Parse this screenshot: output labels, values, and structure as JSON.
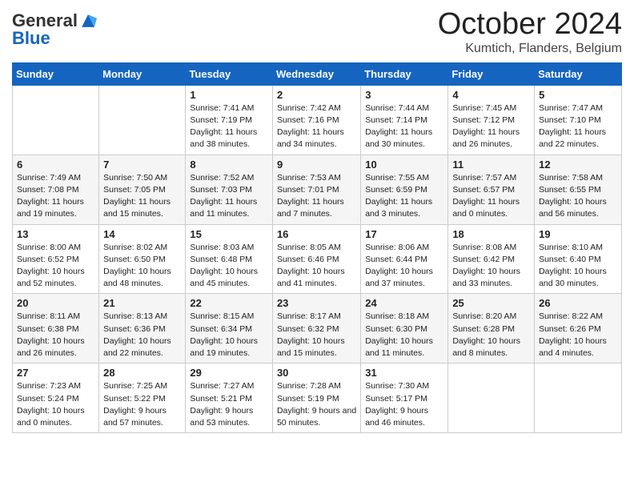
{
  "logo": {
    "general": "General",
    "blue": "Blue"
  },
  "header": {
    "month": "October 2024",
    "location": "Kumtich, Flanders, Belgium"
  },
  "weekdays": [
    "Sunday",
    "Monday",
    "Tuesday",
    "Wednesday",
    "Thursday",
    "Friday",
    "Saturday"
  ],
  "weeks": [
    [
      {
        "day": "",
        "info": ""
      },
      {
        "day": "",
        "info": ""
      },
      {
        "day": "1",
        "info": "Sunrise: 7:41 AM\nSunset: 7:19 PM\nDaylight: 11 hours\nand 38 minutes."
      },
      {
        "day": "2",
        "info": "Sunrise: 7:42 AM\nSunset: 7:16 PM\nDaylight: 11 hours\nand 34 minutes."
      },
      {
        "day": "3",
        "info": "Sunrise: 7:44 AM\nSunset: 7:14 PM\nDaylight: 11 hours\nand 30 minutes."
      },
      {
        "day": "4",
        "info": "Sunrise: 7:45 AM\nSunset: 7:12 PM\nDaylight: 11 hours\nand 26 minutes."
      },
      {
        "day": "5",
        "info": "Sunrise: 7:47 AM\nSunset: 7:10 PM\nDaylight: 11 hours\nand 22 minutes."
      }
    ],
    [
      {
        "day": "6",
        "info": "Sunrise: 7:49 AM\nSunset: 7:08 PM\nDaylight: 11 hours\nand 19 minutes."
      },
      {
        "day": "7",
        "info": "Sunrise: 7:50 AM\nSunset: 7:05 PM\nDaylight: 11 hours\nand 15 minutes."
      },
      {
        "day": "8",
        "info": "Sunrise: 7:52 AM\nSunset: 7:03 PM\nDaylight: 11 hours\nand 11 minutes."
      },
      {
        "day": "9",
        "info": "Sunrise: 7:53 AM\nSunset: 7:01 PM\nDaylight: 11 hours\nand 7 minutes."
      },
      {
        "day": "10",
        "info": "Sunrise: 7:55 AM\nSunset: 6:59 PM\nDaylight: 11 hours\nand 3 minutes."
      },
      {
        "day": "11",
        "info": "Sunrise: 7:57 AM\nSunset: 6:57 PM\nDaylight: 11 hours\nand 0 minutes."
      },
      {
        "day": "12",
        "info": "Sunrise: 7:58 AM\nSunset: 6:55 PM\nDaylight: 10 hours\nand 56 minutes."
      }
    ],
    [
      {
        "day": "13",
        "info": "Sunrise: 8:00 AM\nSunset: 6:52 PM\nDaylight: 10 hours\nand 52 minutes."
      },
      {
        "day": "14",
        "info": "Sunrise: 8:02 AM\nSunset: 6:50 PM\nDaylight: 10 hours\nand 48 minutes."
      },
      {
        "day": "15",
        "info": "Sunrise: 8:03 AM\nSunset: 6:48 PM\nDaylight: 10 hours\nand 45 minutes."
      },
      {
        "day": "16",
        "info": "Sunrise: 8:05 AM\nSunset: 6:46 PM\nDaylight: 10 hours\nand 41 minutes."
      },
      {
        "day": "17",
        "info": "Sunrise: 8:06 AM\nSunset: 6:44 PM\nDaylight: 10 hours\nand 37 minutes."
      },
      {
        "day": "18",
        "info": "Sunrise: 8:08 AM\nSunset: 6:42 PM\nDaylight: 10 hours\nand 33 minutes."
      },
      {
        "day": "19",
        "info": "Sunrise: 8:10 AM\nSunset: 6:40 PM\nDaylight: 10 hours\nand 30 minutes."
      }
    ],
    [
      {
        "day": "20",
        "info": "Sunrise: 8:11 AM\nSunset: 6:38 PM\nDaylight: 10 hours\nand 26 minutes."
      },
      {
        "day": "21",
        "info": "Sunrise: 8:13 AM\nSunset: 6:36 PM\nDaylight: 10 hours\nand 22 minutes."
      },
      {
        "day": "22",
        "info": "Sunrise: 8:15 AM\nSunset: 6:34 PM\nDaylight: 10 hours\nand 19 minutes."
      },
      {
        "day": "23",
        "info": "Sunrise: 8:17 AM\nSunset: 6:32 PM\nDaylight: 10 hours\nand 15 minutes."
      },
      {
        "day": "24",
        "info": "Sunrise: 8:18 AM\nSunset: 6:30 PM\nDaylight: 10 hours\nand 11 minutes."
      },
      {
        "day": "25",
        "info": "Sunrise: 8:20 AM\nSunset: 6:28 PM\nDaylight: 10 hours\nand 8 minutes."
      },
      {
        "day": "26",
        "info": "Sunrise: 8:22 AM\nSunset: 6:26 PM\nDaylight: 10 hours\nand 4 minutes."
      }
    ],
    [
      {
        "day": "27",
        "info": "Sunrise: 7:23 AM\nSunset: 5:24 PM\nDaylight: 10 hours\nand 0 minutes."
      },
      {
        "day": "28",
        "info": "Sunrise: 7:25 AM\nSunset: 5:22 PM\nDaylight: 9 hours\nand 57 minutes."
      },
      {
        "day": "29",
        "info": "Sunrise: 7:27 AM\nSunset: 5:21 PM\nDaylight: 9 hours\nand 53 minutes."
      },
      {
        "day": "30",
        "info": "Sunrise: 7:28 AM\nSunset: 5:19 PM\nDaylight: 9 hours\nand 50 minutes."
      },
      {
        "day": "31",
        "info": "Sunrise: 7:30 AM\nSunset: 5:17 PM\nDaylight: 9 hours\nand 46 minutes."
      },
      {
        "day": "",
        "info": ""
      },
      {
        "day": "",
        "info": ""
      }
    ]
  ]
}
